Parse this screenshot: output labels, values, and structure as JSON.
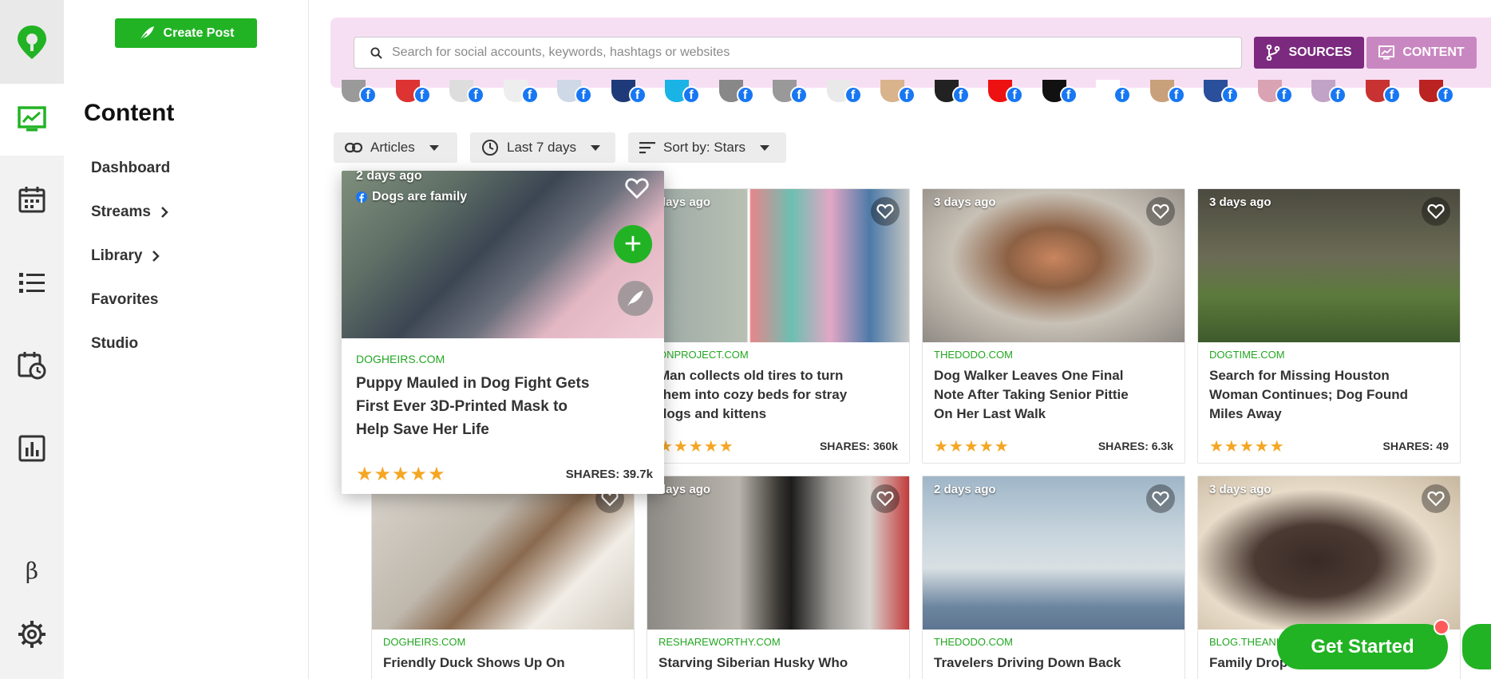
{
  "app": {
    "create_post_label": "Create Post",
    "section_title": "Content"
  },
  "sidebar": {
    "items": [
      {
        "label": "Dashboard",
        "has_chevron": false
      },
      {
        "label": "Streams",
        "has_chevron": true
      },
      {
        "label": "Library",
        "has_chevron": true
      },
      {
        "label": "Favorites",
        "has_chevron": false
      },
      {
        "label": "Studio",
        "has_chevron": false
      }
    ],
    "beta_label": "β"
  },
  "search": {
    "placeholder": "Search for social accounts, keywords, hashtags or websites",
    "value": "",
    "sources_label": "SOURCES",
    "content_label": "CONTENT"
  },
  "filters": {
    "type_label": "Articles",
    "date_label": "Last 7 days",
    "sort_label": "Sort by: Stars"
  },
  "colors": {
    "brand_green": "#22b324",
    "sources_purple": "#7b2a7f",
    "content_pink": "#c987c1",
    "header_bg": "#f7dff3",
    "star": "#f5a623",
    "facebook": "#1877f2"
  },
  "hovered_card": {
    "date": "2 days ago",
    "page_name": "Dogs are family",
    "domain": "DOGHEIRS.COM",
    "headline": "Puppy Mauled in Dog Fight Gets First Ever 3D-Printed Mask to Help Save Her Life",
    "stars": "★★★★★",
    "shares": "SHARES: 39.7k"
  },
  "cards": [
    {
      "date": "days ago",
      "domain": "ONPROJECT.COM",
      "headline": "Man collects old tires to turn them into cozy beds for stray dogs and kittens",
      "stars": "★★★★★",
      "shares": "SHARES: 360k"
    },
    {
      "date": "3 days ago",
      "domain": "THEDODO.COM",
      "headline": "Dog Walker Leaves One Final Note After Taking Senior Pittie On Her Last Walk",
      "stars": "★★★★★",
      "shares": "SHARES: 6.3k"
    },
    {
      "date": "3 days ago",
      "domain": "DOGTIME.COM",
      "headline": "Search for Missing Houston Woman Continues; Dog Found Miles Away",
      "stars": "★★★★★",
      "shares": "SHARES: 49"
    },
    {
      "date": "",
      "domain": "DOGHEIRS.COM",
      "headline": "Friendly Duck Shows Up On",
      "stars": "",
      "shares": ""
    },
    {
      "date": "days ago",
      "domain": "RESHAREWORTHY.COM",
      "headline": "Starving Siberian Husky Who",
      "stars": "",
      "shares": ""
    },
    {
      "date": "2 days ago",
      "domain": "THEDODO.COM",
      "headline": "Travelers Driving Down Back",
      "stars": "",
      "shares": ""
    },
    {
      "date": "3 days ago",
      "domain": "BLOG.THEANIN",
      "headline": "Family Drop",
      "stars": "",
      "shares": ""
    }
  ],
  "cta": {
    "get_started_label": "Get Started"
  },
  "icons": {
    "logo": "location-pin-logo-icon",
    "content": "chart-monitor-icon",
    "calendar": "calendar-icon",
    "list": "list-icon",
    "schedule": "calendar-clock-icon",
    "analytics": "bar-chart-icon",
    "settings": "gear-icon"
  }
}
